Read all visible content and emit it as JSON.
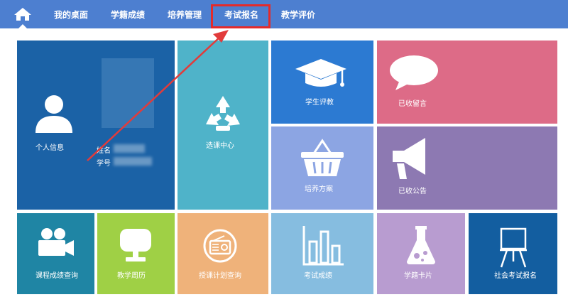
{
  "nav": {
    "home_icon": "home-icon",
    "items": [
      "我的桌面",
      "学籍成绩",
      "培养管理",
      "考试报名",
      "教学评价"
    ],
    "highlight_color": "#e32b2b"
  },
  "tiles": {
    "personal_info": {
      "label": "个人信息",
      "name_label": "姓名",
      "id_label": "学号"
    },
    "course_select": {
      "label": "选课中心"
    },
    "student_eval": {
      "label": "学生评教"
    },
    "received_messages": {
      "label": "已收留言"
    },
    "training_plan": {
      "label": "培养方案"
    },
    "received_notices": {
      "label": "已收公告"
    },
    "course_grade_query": {
      "label": "课程成绩查询"
    },
    "teaching_calendar": {
      "label": "教学周历"
    },
    "teaching_plan_query": {
      "label": "授课计划查询"
    },
    "exam_scores": {
      "label": "考试成绩"
    },
    "student_card": {
      "label": "学籍卡片"
    },
    "social_exam_registration": {
      "label": "社会考试报名"
    }
  },
  "colors": {
    "nav_bg": "#4d7fd0",
    "tile_dark_blue": "#1b62a6",
    "tile_teal": "#4fb3c9",
    "tile_blue": "#2c7ad2",
    "tile_pink": "#dd6b87",
    "tile_lavender": "#8ca5e3",
    "tile_purple": "#8d79b2",
    "tile_teal_blue": "#1f85a4",
    "tile_green": "#9fd045",
    "tile_orange": "#efb27a",
    "tile_light_blue": "#86bde0",
    "tile_light_purple": "#b89cd0",
    "tile_navy": "#135ea0",
    "arrow": "#e23b3b"
  }
}
